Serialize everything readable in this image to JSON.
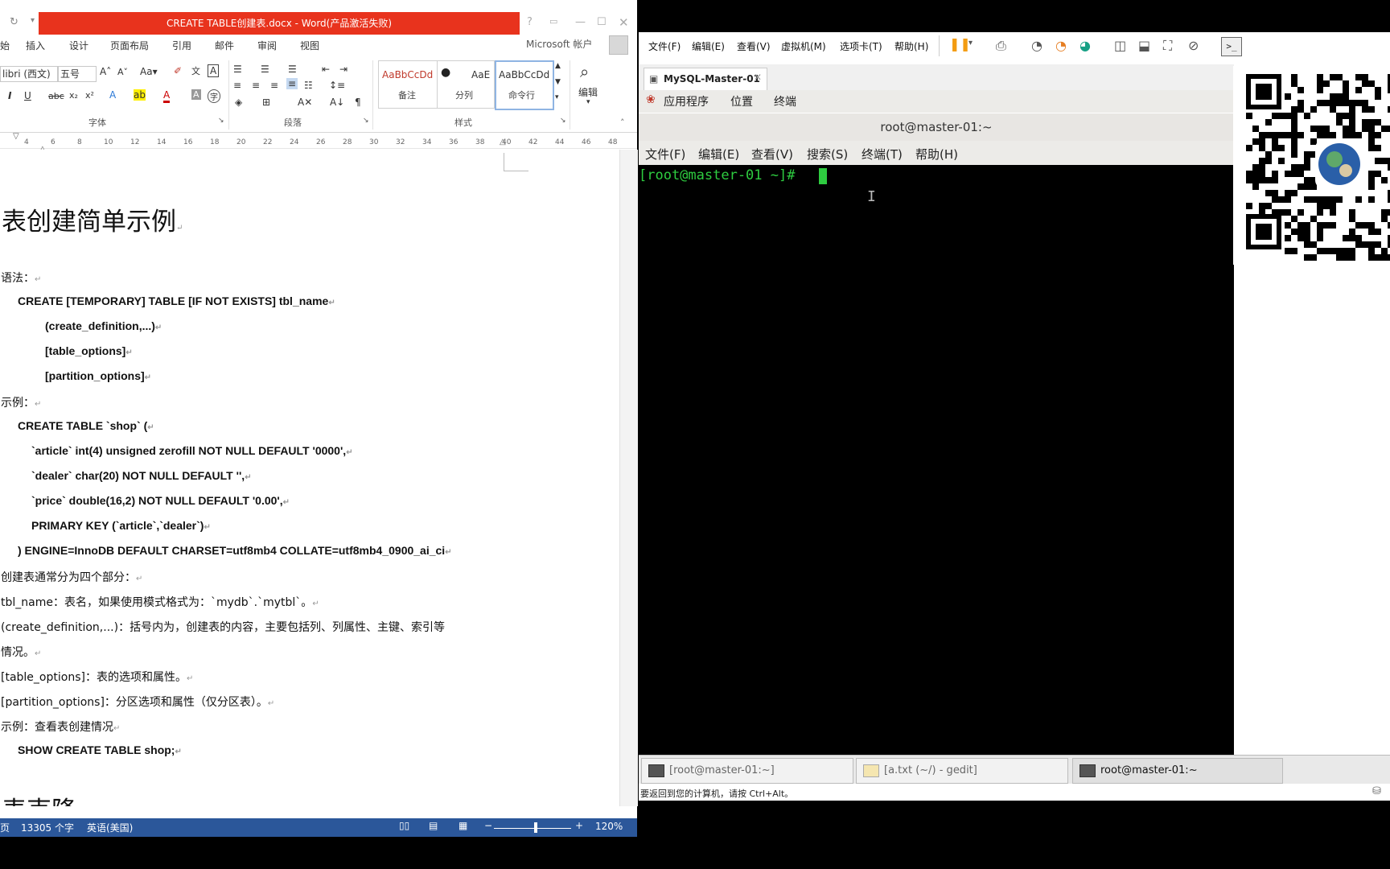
{
  "word": {
    "title": "CREATE TABLE创建表.docx - Word(产品激活失败)",
    "account": "Microsoft 帐户",
    "tabs": [
      "插入",
      "设计",
      "页面布局",
      "引用",
      "邮件",
      "审阅",
      "视图"
    ],
    "font_name": "libri (西文)",
    "font_size": "五号",
    "group_font": "字体",
    "group_paragraph": "段落",
    "group_styles": "样式",
    "group_edit": "编辑",
    "styles": [
      {
        "preview": "AaBbCcDd",
        "label": "备注"
      },
      {
        "preview": "AaE",
        "label": "分列"
      },
      {
        "preview": "AaBbCcDd",
        "label": "命令行"
      }
    ],
    "ruler_numbers": [
      "4",
      "6",
      "8",
      "10",
      "12",
      "14",
      "16",
      "18",
      "20",
      "22",
      "24",
      "26",
      "28",
      "30",
      "32",
      "34",
      "36",
      "38",
      "40",
      "42",
      "44",
      "46",
      "48"
    ],
    "doc": {
      "heading": "表创建简单示例",
      "syntax_label": "语法：",
      "syntax": [
        "CREATE [TEMPORARY] TABLE [IF NOT EXISTS] tbl_name",
        "(create_definition,...)",
        "[table_options]",
        "[partition_options]"
      ],
      "example_label": "示例：",
      "example": [
        "CREATE TABLE `shop` (",
        "`article` int(4) unsigned zerofill NOT NULL DEFAULT '0000',",
        "`dealer` char(20) NOT NULL DEFAULT '',",
        "`price` double(16,2) NOT NULL DEFAULT '0.00',",
        "PRIMARY KEY (`article`,`dealer`)",
        ") ENGINE=InnoDB DEFAULT CHARSET=utf8mb4 COLLATE=utf8mb4_0900_ai_ci"
      ],
      "parts_intro": "创建表通常分为四个部分：",
      "parts": [
        "tbl_name：表名，如果使用模式格式为：`mydb`.`mytbl`。",
        "(create_definition,...)：括号内为，创建表的内容，主要包括列、列属性、主键、索引等",
        "情况。",
        "[table_options]：表的选项和属性。",
        "[partition_options]：分区选项和属性（仅分区表）。"
      ],
      "view_example": "示例：查看表创建情况",
      "show_cmd": "SHOW CREATE TABLE shop;",
      "next_heading_partial": "表克隆"
    },
    "status": {
      "page": "页",
      "words": "13305 个字",
      "lang": "英语(美国)",
      "zoom": "120%"
    }
  },
  "vm": {
    "menu": [
      "文件(F)",
      "编辑(E)",
      "查看(V)",
      "虚拟机(M)",
      "选项卡(T)",
      "帮助(H)"
    ],
    "tab": "MySQL-Master-01",
    "gnome_menu": [
      "应用程序",
      "位置",
      "终端"
    ],
    "terminal_title": "root@master-01:~",
    "terminal_menu": [
      "文件(F)",
      "编辑(E)",
      "查看(V)",
      "搜索(S)",
      "终端(T)",
      "帮助(H)"
    ],
    "prompt": "[root@master-01 ~]# ",
    "tasks": [
      "[root@master-01:~]",
      "[a.txt (~/) - gedit]",
      "root@master-01:~"
    ],
    "status": "要返回到您的计算机，请按 Ctrl+Alt。"
  }
}
